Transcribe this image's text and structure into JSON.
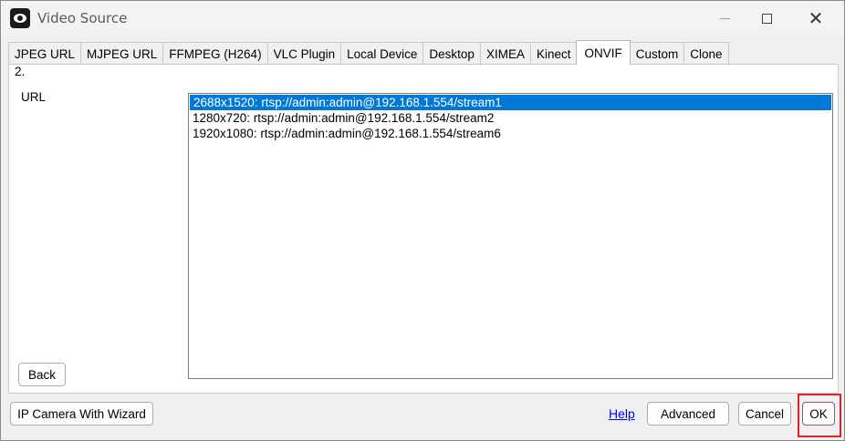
{
  "window": {
    "title": "Video Source"
  },
  "tabs": [
    {
      "label": "JPEG URL",
      "active": false
    },
    {
      "label": "MJPEG URL",
      "active": false
    },
    {
      "label": "FFMPEG (H264)",
      "active": false
    },
    {
      "label": "VLC Plugin",
      "active": false
    },
    {
      "label": "Local Device",
      "active": false
    },
    {
      "label": "Desktop",
      "active": false
    },
    {
      "label": "XIMEA",
      "active": false
    },
    {
      "label": "Kinect",
      "active": false
    },
    {
      "label": "ONVIF",
      "active": true
    },
    {
      "label": "Custom",
      "active": false
    },
    {
      "label": "Clone",
      "active": false
    }
  ],
  "panel": {
    "step": "2.",
    "url_label": "URL",
    "streams": [
      {
        "text": "2688x1520: rtsp://admin:admin@192.168.1.554/stream1",
        "selected": true
      },
      {
        "text": "1280x720: rtsp://admin:admin@192.168.1.554/stream2",
        "selected": false
      },
      {
        "text": "1920x1080: rtsp://admin:admin@192.168.1.554/stream6",
        "selected": false
      }
    ],
    "back_label": "Back"
  },
  "footer": {
    "wizard_label": "IP Camera With Wizard",
    "help_label": "Help",
    "advanced_label": "Advanced",
    "cancel_label": "Cancel",
    "ok_label": "OK"
  },
  "colors": {
    "selection": "#0078d7",
    "highlight": "#e0202a",
    "link": "#0000ee"
  }
}
